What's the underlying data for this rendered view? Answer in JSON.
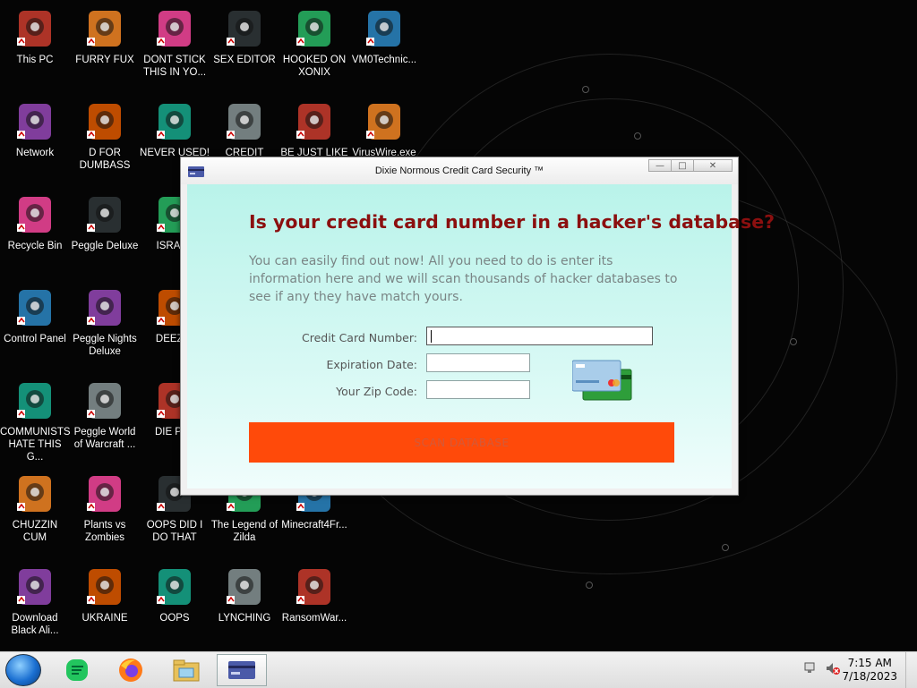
{
  "desktop": {
    "icons": [
      {
        "label": "This PC"
      },
      {
        "label": "FURRY FUX"
      },
      {
        "label": "DONT STICK THIS IN YO..."
      },
      {
        "label": "SEX EDITOR"
      },
      {
        "label": "HOOKED ON XONIX"
      },
      {
        "label": "VM0Technic..."
      },
      {
        "label": "Network"
      },
      {
        "label": "D FOR DUMBASS"
      },
      {
        "label": "NEVER USED!"
      },
      {
        "label": "CREDIT CARD"
      },
      {
        "label": "BE JUST LIKE"
      },
      {
        "label": "VirusWire.exe"
      },
      {
        "label": "Recycle Bin"
      },
      {
        "label": "Peggle Deluxe"
      },
      {
        "label": "ISRAEL"
      },
      {
        "label": "Control Panel"
      },
      {
        "label": "Peggle Nights Deluxe"
      },
      {
        "label": "DEEZ N"
      },
      {
        "label": "COMMUNISTS HATE THIS G..."
      },
      {
        "label": "Peggle World of Warcraft ..."
      },
      {
        "label": "DIE PLE"
      },
      {
        "label": "CHUZZIN CUM"
      },
      {
        "label": "Plants vs Zombies"
      },
      {
        "label": "OOPS DID I DO THAT"
      },
      {
        "label": "The Legend of Zilda"
      },
      {
        "label": "Minecraft4Fr..."
      },
      {
        "label": "Download Black Ali..."
      },
      {
        "label": "UKRAINE"
      },
      {
        "label": "OOPS"
      },
      {
        "label": "LYNCHING"
      },
      {
        "label": "RansomWar..."
      }
    ]
  },
  "window": {
    "title": "Dixie Normous Credit Card Security ™",
    "heading": "Is your credit card number in a hacker's database?",
    "description": "You can easily find out now! All you need to do is enter its information here and we will scan thousands of hacker databases to see if any they have match yours.",
    "fields": {
      "card_number_label": "Credit Card Number:",
      "card_number_value": "",
      "expiration_label": "Expiration Date:",
      "expiration_value": "",
      "zip_label": "Your Zip Code:",
      "zip_value": ""
    },
    "scan_button_label": "SCAN DATABASE",
    "colors": {
      "heading": "#8b0f0f",
      "button": "#ff4a0a",
      "client_bg": "#c6f6ef"
    }
  },
  "taskbar": {
    "items": [
      "start-orb",
      "notes-app",
      "firefox",
      "file-explorer",
      "credit-card-app"
    ],
    "active_item": "credit-card-app",
    "clock_time": "7:15 AM",
    "clock_date": "7/18/2023"
  }
}
